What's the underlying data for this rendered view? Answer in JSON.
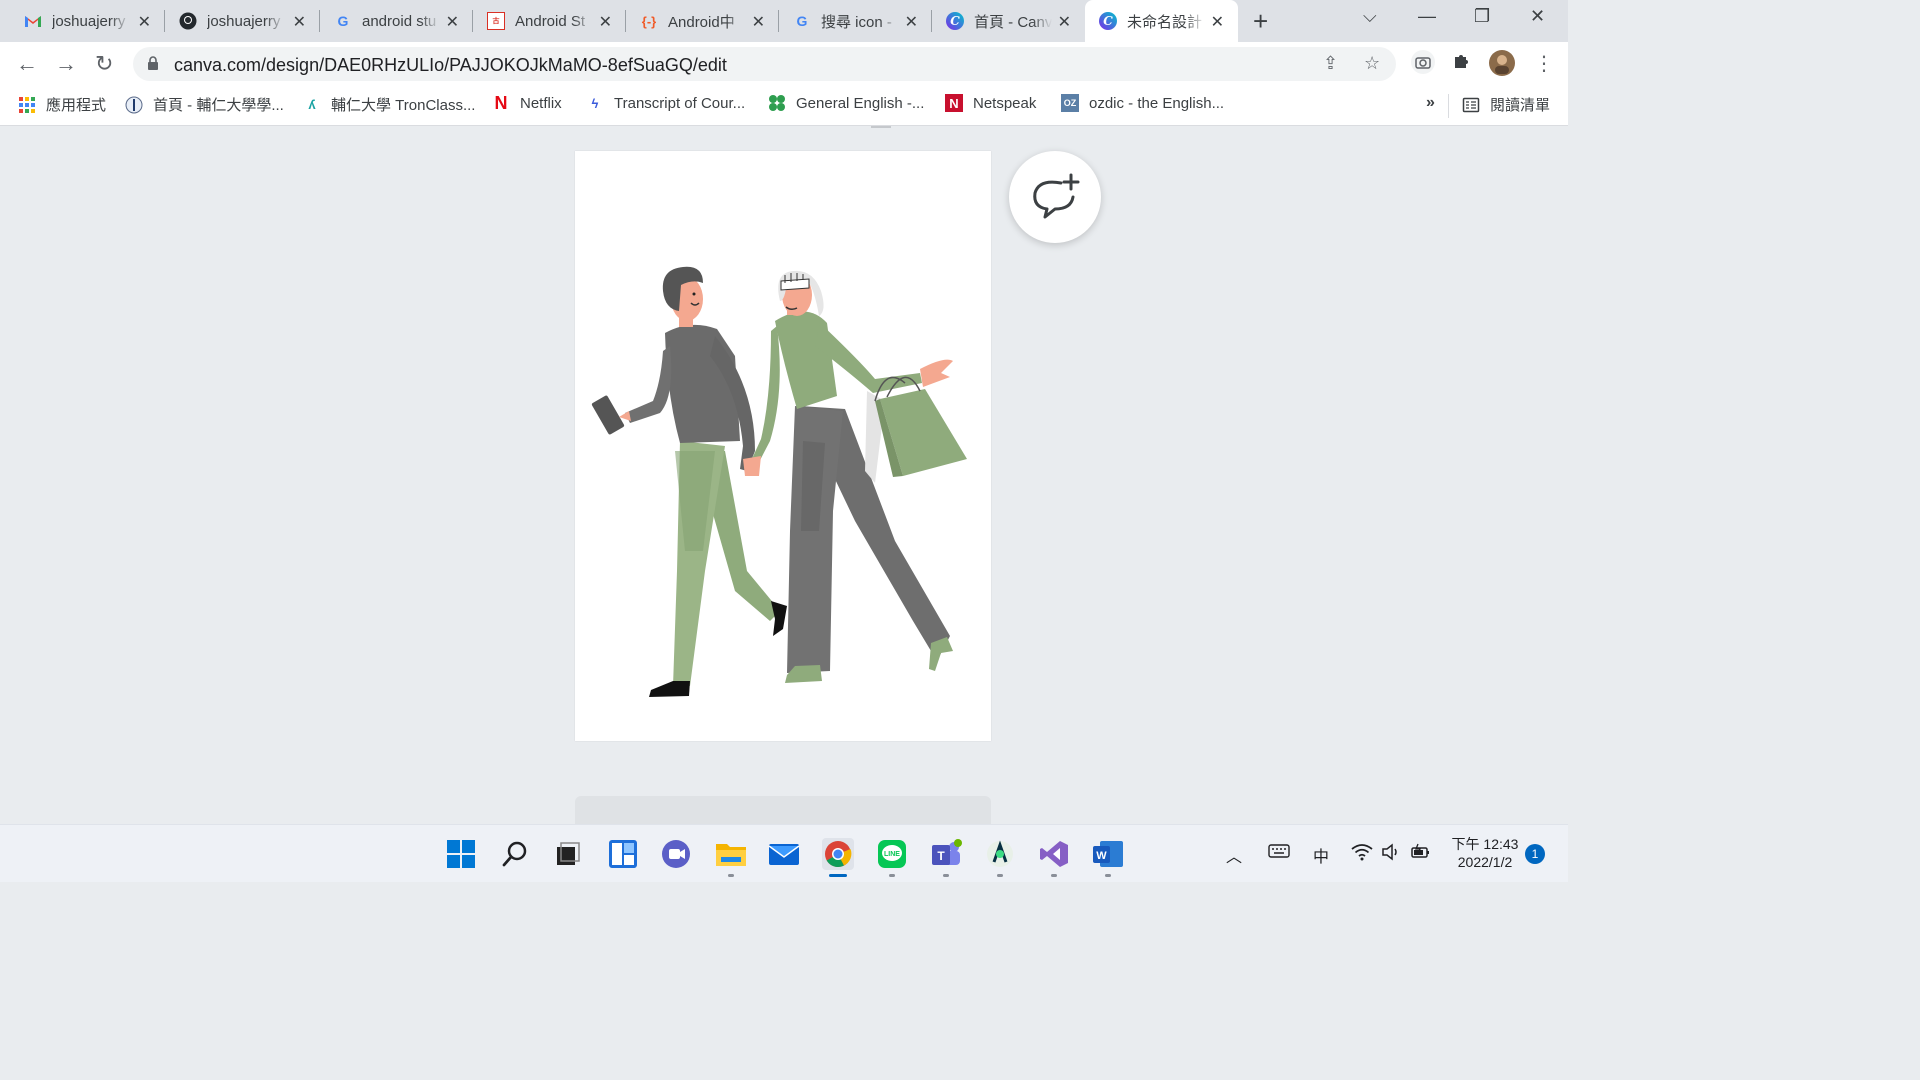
{
  "browser": {
    "tabs": [
      {
        "title": "joshuajerry",
        "favicon": "gmail-icon"
      },
      {
        "title": "joshuajerry",
        "favicon": "github-icon"
      },
      {
        "title": "android stu",
        "favicon": "google-icon"
      },
      {
        "title": "Android St",
        "favicon": "site-icon"
      },
      {
        "title": "Android中",
        "favicon": "code-icon"
      },
      {
        "title": "搜尋 icon -",
        "favicon": "google-icon"
      },
      {
        "title": "首頁 - Canv",
        "favicon": "canva-icon"
      },
      {
        "title": "未命名設計",
        "favicon": "canva-icon"
      }
    ],
    "url": "canva.com/design/DAE0RHzULIo/PAJJOKOJkMaMO-8efSuaGQ/edit",
    "bookmarks": [
      {
        "label": "應用程式",
        "icon": "apps-grid-icon"
      },
      {
        "label": "首頁 - 輔仁大學學...",
        "icon": "fju-logo-icon"
      },
      {
        "label": "輔仁大學 TronClass...",
        "icon": "tronclass-icon"
      },
      {
        "label": "Netflix",
        "icon": "netflix-icon"
      },
      {
        "label": "Transcript of Cour...",
        "icon": "transcript-icon"
      },
      {
        "label": "General English -...",
        "icon": "general-english-icon"
      },
      {
        "label": "Netspeak",
        "icon": "netspeak-icon"
      },
      {
        "label": "ozdic - the English...",
        "icon": "ozdic-icon"
      }
    ],
    "more_bookmarks": "»",
    "reading_list": "閱讀清單"
  },
  "taskbar": {
    "apps": [
      "start-icon",
      "search-icon",
      "task-view-icon",
      "widgets-icon",
      "teams-chat-icon",
      "file-explorer-icon",
      "mail-icon",
      "chrome-icon",
      "line-icon",
      "teams-icon",
      "android-studio-icon",
      "visual-studio-icon",
      "word-icon"
    ],
    "ime": "中",
    "time": "下午 12:43",
    "date": "2022/1/2",
    "notifications": "1"
  },
  "colors": {
    "green": "#8fab7c",
    "gray": "#6b6b6b",
    "accent": "#0067c0"
  }
}
